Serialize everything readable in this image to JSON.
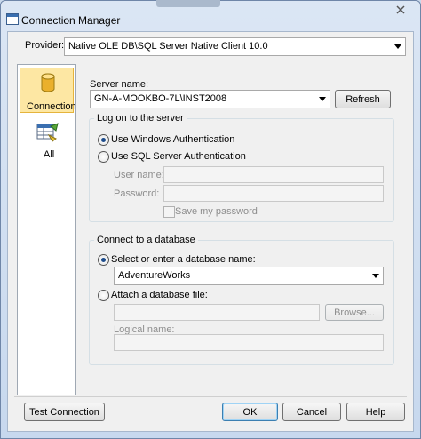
{
  "window": {
    "title": "Connection Manager"
  },
  "provider": {
    "label": "Provider:",
    "value": "Native OLE DB\\SQL Server Native Client 10.0"
  },
  "sidebar": {
    "items": [
      {
        "label": "Connection",
        "icon": "database-cylinder-icon",
        "selected": true
      },
      {
        "label": "All",
        "icon": "properties-grid-icon",
        "selected": false
      }
    ]
  },
  "server": {
    "label": "Server name:",
    "value": "GN-A-MOOKBO-7L\\INST2008",
    "refresh_label": "Refresh"
  },
  "logon": {
    "legend": "Log on to the server",
    "windows_auth_label": "Use Windows Authentication",
    "sql_auth_label": "Use SQL Server Authentication",
    "username_label": "User name:",
    "password_label": "Password:",
    "save_password_label": "Save my password"
  },
  "database": {
    "legend": "Connect to a database",
    "select_label": "Select or enter a database name:",
    "selected_db": "AdventureWorks",
    "attach_label": "Attach a database file:",
    "browse_label": "Browse...",
    "logical_name_label": "Logical name:"
  },
  "footer": {
    "test_label": "Test Connection",
    "ok_label": "OK",
    "cancel_label": "Cancel",
    "help_label": "Help"
  },
  "colors": {
    "accent": "#1e4d8c",
    "selection": "#fde7a3"
  }
}
